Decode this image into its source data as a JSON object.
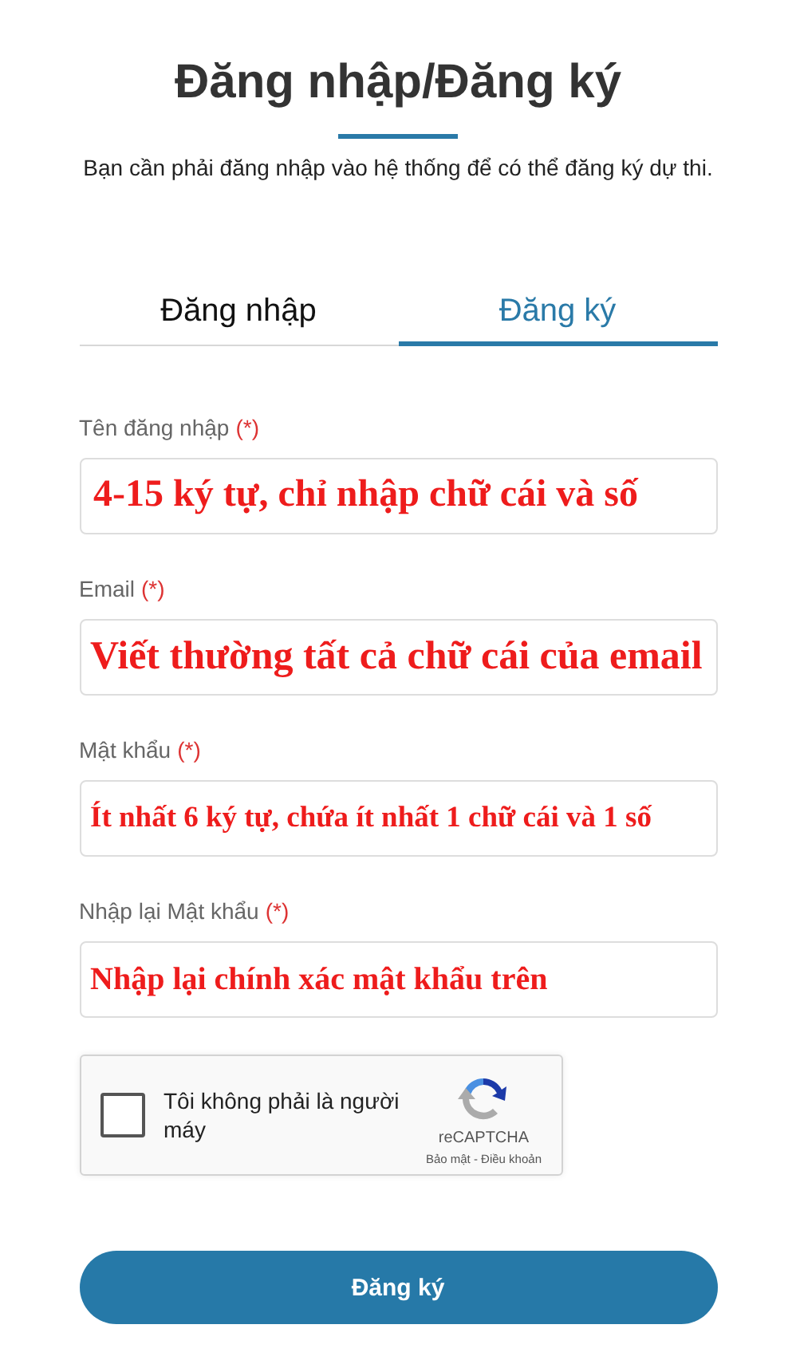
{
  "title": "Đăng nhập/Đăng ký",
  "subtitle": "Bạn cần phải đăng nhập vào hệ thống để có thể đăng ký dự thi.",
  "tabs": [
    {
      "label": "Đăng nhập",
      "selected": false
    },
    {
      "label": "Đăng ký",
      "selected": true
    }
  ],
  "fields": [
    {
      "label": "Tên đăng nhập",
      "required_mark": "(*)",
      "value": "4-15 ký tự, chỉ nhập chữ cái và số"
    },
    {
      "label": "Email",
      "required_mark": "(*)",
      "value": "Viết thường tất cả chữ cái của email"
    },
    {
      "label": "Mật khẩu",
      "required_mark": "(*)",
      "value": "Ít nhất 6 ký tự, chứa ít nhất 1 chữ cái và 1 số"
    },
    {
      "label": "Nhập lại Mật khẩu",
      "required_mark": "(*)",
      "value": "Nhập lại chính xác mật khẩu trên"
    }
  ],
  "captcha": {
    "label": "Tôi không phải là người máy",
    "checked": false,
    "brand": "reCAPTCHA",
    "links": "Bảo mật - Điều khoản"
  },
  "submit_button": "Đăng ký"
}
